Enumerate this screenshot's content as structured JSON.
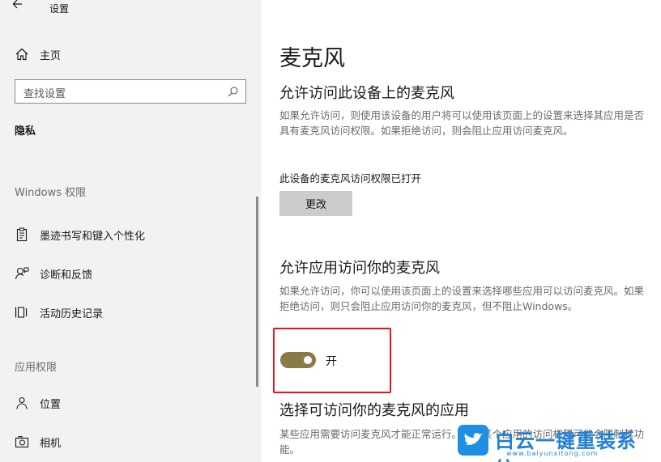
{
  "app": {
    "title": "设置"
  },
  "sidebar": {
    "home_label": "主页",
    "search_placeholder": "查找设置",
    "section_title": "隐私",
    "groups": [
      {
        "label": "Windows 权限",
        "items": [
          {
            "label": "墨迹书写和键入个性化",
            "icon": "clipboard-icon"
          },
          {
            "label": "诊断和反馈",
            "icon": "feedback-person-icon"
          },
          {
            "label": "活动历史记录",
            "icon": "activity-history-icon"
          }
        ]
      },
      {
        "label": "应用权限",
        "items": [
          {
            "label": "位置",
            "icon": "location-person-icon"
          },
          {
            "label": "相机",
            "icon": "camera-icon"
          }
        ]
      }
    ]
  },
  "main": {
    "page_title": "麦克风",
    "device_access": {
      "heading": "允许访问此设备上的麦克风",
      "description": "如果允许访问，则使用该设备的用户将可以使用该页面上的设置来选择其应用是否具有麦克风访问权限。如果拒绝访问，则会阻止应用访问麦克风。",
      "status": "此设备的麦克风访问权限已打开",
      "change_button": "更改"
    },
    "app_access": {
      "heading": "允许应用访问你的麦克风",
      "description": "如果允许访问，你可以使用该页面上的设置来选择哪些应用可以访问麦克风。如果拒绝访问，则只会阻止应用访问你的麦克风，但不阻止Windows。",
      "toggle_state": "开",
      "toggle_on": true,
      "toggle_color": "#8a7a45"
    },
    "choose_apps": {
      "heading": "选择可访问你的麦克风的应用",
      "description": "某些应用需要访问麦克风才能正常运行。关闭某个应用的访问权限可能会限制其功能。"
    }
  },
  "watermark": {
    "title": "白云一键重装系统",
    "url": "www.baiyunxitong.com"
  },
  "colors": {
    "sidebar_bg": "#f2f2f2",
    "accent_highlight": "#e8141e",
    "watermark_blue": "#1f8fe6"
  }
}
